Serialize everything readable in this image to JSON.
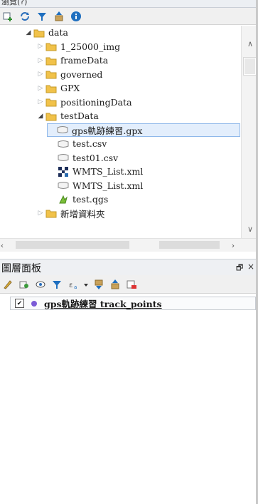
{
  "browser": {
    "title": "瀏覽(?)",
    "toolbar": [
      {
        "icon": "add-layer-icon"
      },
      {
        "icon": "refresh-icon"
      },
      {
        "icon": "filter-icon"
      },
      {
        "icon": "collapse-all-icon"
      },
      {
        "icon": "info-icon"
      }
    ],
    "tree": [
      {
        "label": "data",
        "depth": 0,
        "state": "open",
        "icon": "folder-icon"
      },
      {
        "label": "1_25000_img",
        "depth": 1,
        "state": "closed",
        "icon": "folder-icon"
      },
      {
        "label": "frameData",
        "depth": 1,
        "state": "closed",
        "icon": "folder-icon"
      },
      {
        "label": "governed",
        "depth": 1,
        "state": "closed",
        "icon": "folder-icon"
      },
      {
        "label": "GPX",
        "depth": 1,
        "state": "closed",
        "icon": "folder-icon"
      },
      {
        "label": "positioningData",
        "depth": 1,
        "state": "closed",
        "icon": "folder-icon"
      },
      {
        "label": "testData",
        "depth": 1,
        "state": "open",
        "icon": "folder-icon"
      },
      {
        "label": "gps軌跡練習.gpx",
        "depth": 2,
        "state": "none",
        "icon": "vector-file-icon",
        "selected": true
      },
      {
        "label": "test.csv",
        "depth": 2,
        "state": "none",
        "icon": "vector-file-icon"
      },
      {
        "label": "test01.csv",
        "depth": 2,
        "state": "none",
        "icon": "vector-file-icon"
      },
      {
        "label": "WMTS_List.xml",
        "depth": 2,
        "state": "none",
        "icon": "raster-file-icon"
      },
      {
        "label": "WMTS_List.xml",
        "depth": 2,
        "state": "none",
        "icon": "vector-file-icon"
      },
      {
        "label": "test.qgs",
        "depth": 2,
        "state": "none",
        "icon": "qgis-project-icon"
      },
      {
        "label": "新增資料夾",
        "depth": 1,
        "state": "closed",
        "icon": "folder-icon"
      }
    ]
  },
  "layers": {
    "title": "圖層面板",
    "float_symbol": "🗗",
    "close_symbol": "×",
    "toolbar": [
      {
        "icon": "style-icon"
      },
      {
        "icon": "add-group-icon"
      },
      {
        "icon": "visibility-icon"
      },
      {
        "icon": "filter-icon"
      },
      {
        "icon": "expression-filter-icon"
      },
      {
        "icon": "expand-all-icon"
      },
      {
        "icon": "collapse-all-icon"
      },
      {
        "icon": "remove-layer-icon"
      }
    ],
    "items": [
      {
        "name": "gps軌跡練習 track_points",
        "checked": true,
        "symbol_color": "#7b5bd6"
      }
    ]
  }
}
